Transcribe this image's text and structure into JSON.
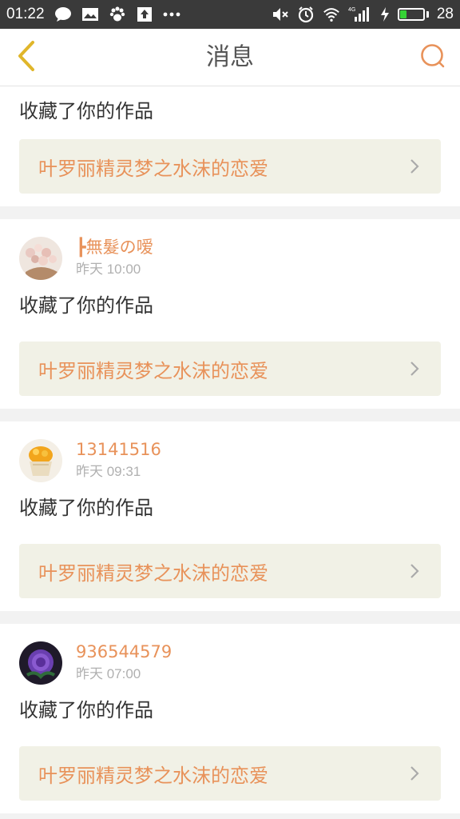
{
  "status_bar": {
    "time": "01:22",
    "battery_level": "28",
    "battery_fraction": 0.28,
    "network_label": "4G",
    "icons": [
      "chat-bubble-icon",
      "image-message-icon",
      "paw-icon",
      "upload-icon",
      "more-dots-icon",
      "mute-icon",
      "alarm-icon",
      "wifi-icon",
      "signal-icon",
      "charging-icon",
      "battery-icon"
    ]
  },
  "nav": {
    "title": "消息",
    "back_icon": "chevron-left-icon",
    "search_icon": "search-icon"
  },
  "colors": {
    "accent": "#e8925a",
    "link_bg": "#f1f1e6",
    "status_bar_bg": "#3a3a3a",
    "back_icon": "#e0b62a"
  },
  "messages": [
    {
      "action": "收藏了你的作品",
      "work_title": "叶罗丽精灵梦之水沫的恋爱"
    },
    {
      "username": "┣無髮の嗳",
      "time": "昨天 10:00",
      "avatar": "flowers-avatar",
      "action": "收藏了你的作品",
      "work_title": "叶罗丽精灵梦之水沫的恋爱"
    },
    {
      "username": "13141516",
      "time": "昨天 09:31",
      "avatar": "cake-avatar",
      "action": "收藏了你的作品",
      "work_title": "叶罗丽精灵梦之水沫的恋爱"
    },
    {
      "username": "936544579",
      "time": "昨天 07:00",
      "avatar": "purple-rose-avatar",
      "action": "收藏了你的作品",
      "work_title": "叶罗丽精灵梦之水沫的恋爱"
    }
  ]
}
